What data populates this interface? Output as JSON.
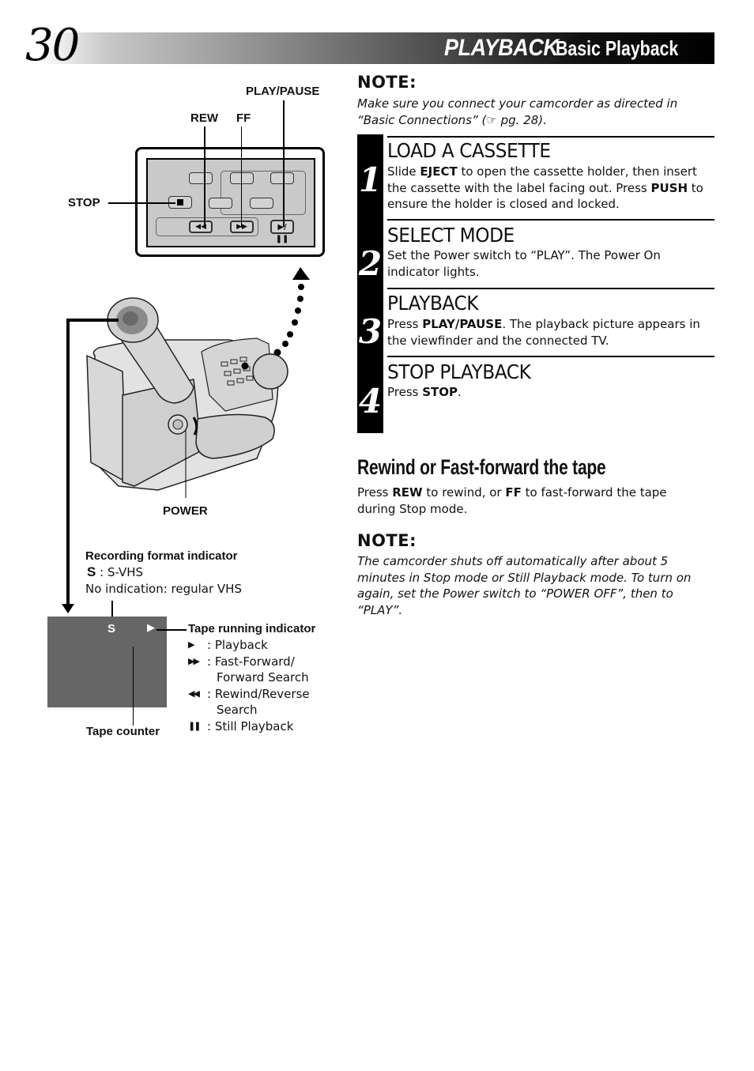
{
  "header": {
    "page_number": "30",
    "section": "PLAYBACK",
    "subsection": "Basic Playback"
  },
  "diagram": {
    "labels": {
      "play_pause": "PLAY/PAUSE",
      "rew": "REW",
      "ff": "FF",
      "stop": "STOP",
      "power": "POWER",
      "recording_format_title": "Recording format indicator",
      "svhs_icon": "S",
      "svhs_text": ": S-VHS",
      "no_indication": "No indication: regular VHS",
      "tape_running_title": "Tape running indicator",
      "tape_counter": "Tape counter"
    },
    "tape_running_items": [
      {
        "icon": "play-icon",
        "glyph": "▶",
        "text": ": Playback"
      },
      {
        "icon": "fast-forward-icon",
        "glyph": "▶▶",
        "text": ": Fast-Forward/"
      },
      {
        "icon": "",
        "glyph": "",
        "text": "Forward Search"
      },
      {
        "icon": "rewind-icon",
        "glyph": "◀◀",
        "text": ": Rewind/Reverse"
      },
      {
        "icon": "",
        "glyph": "",
        "text": "Search"
      },
      {
        "icon": "pause-icon",
        "glyph": "❚❚",
        "text": ": Still Playback"
      }
    ],
    "screen_indicators": {
      "format": "S",
      "running": "▶"
    }
  },
  "note_top": {
    "heading": "NOTE:",
    "text_1": "Make sure you connect your camcorder as directed in",
    "text_2": "“Basic Connections” (",
    "ref_icon": "☞",
    "text_3": " pg. 28)."
  },
  "steps": [
    {
      "number": "1",
      "title": "LOAD A CASSETTE",
      "body": [
        {
          "t": "Slide ",
          "b": false
        },
        {
          "t": "EJECT",
          "b": true
        },
        {
          "t": " to open the cassette holder, then insert the cassette with the label facing out. Press ",
          "b": false
        },
        {
          "t": "PUSH",
          "b": true
        },
        {
          "t": " to ensure the holder is closed and locked.",
          "b": false
        }
      ]
    },
    {
      "number": "2",
      "title": "SELECT MODE",
      "body": [
        {
          "t": "Set the Power switch to “PLAY”. The Power On indicator lights.",
          "b": false
        }
      ]
    },
    {
      "number": "3",
      "title": "PLAYBACK",
      "body": [
        {
          "t": "Press ",
          "b": false
        },
        {
          "t": "PLAY/PAUSE",
          "b": true
        },
        {
          "t": ". The playback picture appears in the viewfinder and the connected TV.",
          "b": false
        }
      ]
    },
    {
      "number": "4",
      "title": "STOP PLAYBACK",
      "body": [
        {
          "t": "Press ",
          "b": false
        },
        {
          "t": "STOP",
          "b": true
        },
        {
          "t": ".",
          "b": false
        }
      ]
    }
  ],
  "rewind_section": {
    "title": "Rewind or Fast-forward the tape",
    "body": [
      {
        "t": "Press ",
        "b": false
      },
      {
        "t": "REW",
        "b": true
      },
      {
        "t": " to rewind, or ",
        "b": false
      },
      {
        "t": "FF",
        "b": true
      },
      {
        "t": " to fast-forward the tape during Stop mode.",
        "b": false
      }
    ]
  },
  "note_bottom": {
    "heading": "NOTE:",
    "text": "The camcorder shuts off automatically after about 5 minutes in Stop mode or Still Playback mode. To turn on again, set the Power switch to “POWER OFF”, then to “PLAY”."
  }
}
